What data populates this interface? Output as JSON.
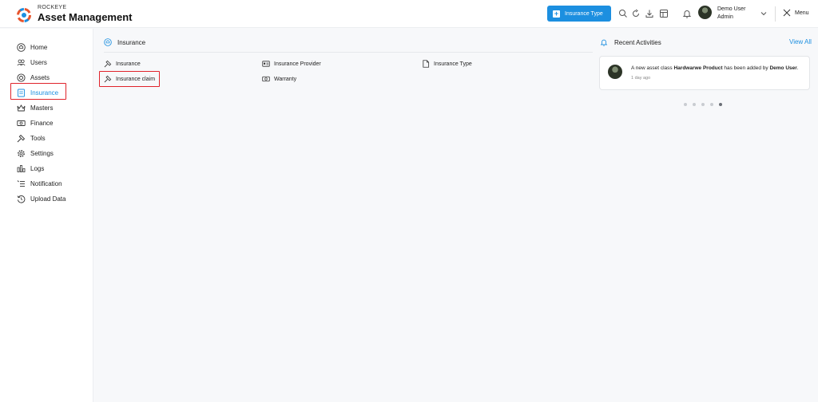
{
  "header": {
    "brand_small": "ROCKEYE",
    "brand_title": "Asset Management",
    "add_button_label": "Insurance Type",
    "user_name": "Demo User",
    "user_role": "Admin",
    "menu_label": "Menu"
  },
  "sidebar": {
    "items": [
      {
        "label": "Home",
        "icon": "home-icon"
      },
      {
        "label": "Users",
        "icon": "users-icon"
      },
      {
        "label": "Assets",
        "icon": "assets-icon"
      },
      {
        "label": "Insurance",
        "icon": "insurance-icon",
        "active": true
      },
      {
        "label": "Masters",
        "icon": "crown-icon"
      },
      {
        "label": "Finance",
        "icon": "money-icon"
      },
      {
        "label": "Tools",
        "icon": "hammer-icon"
      },
      {
        "label": "Settings",
        "icon": "gear-icon"
      },
      {
        "label": "Logs",
        "icon": "chart-icon"
      },
      {
        "label": "Notification",
        "icon": "list-icon"
      },
      {
        "label": "Upload Data",
        "icon": "history-icon"
      }
    ]
  },
  "main": {
    "breadcrumb": "Insurance",
    "links": [
      {
        "label": "Insurance",
        "icon": "hammer-icon"
      },
      {
        "label": "Insurance Provider",
        "icon": "card-icon"
      },
      {
        "label": "Insurance Type",
        "icon": "document-icon"
      },
      {
        "label": "Insurance claim",
        "icon": "hammer-icon"
      },
      {
        "label": "Warranty",
        "icon": "money-icon"
      }
    ]
  },
  "activities": {
    "title": "Recent Activities",
    "view_all": "View All",
    "items": [
      {
        "prefix": "A new asset class ",
        "entity": "Hardwarwe Product",
        "middle": " has been added by ",
        "actor": "Demo User",
        "suffix": ".",
        "time": "1 day ago"
      }
    ],
    "pages": 5,
    "current_page": 5
  },
  "colors": {
    "accent": "#1c8fe0",
    "highlight": "#e0232b"
  }
}
